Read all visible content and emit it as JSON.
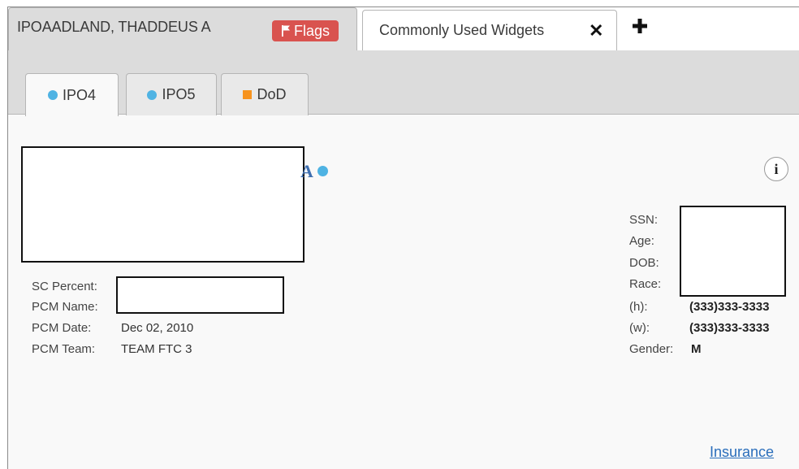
{
  "patient_tab": {
    "name": "IPOAADLAND, THADDEUS A",
    "flags_label": "Flags",
    "flags_color": "#d9534f"
  },
  "widgets_tab": {
    "label": "Commonly Used Widgets",
    "close_icon": "close-icon"
  },
  "add_tab_icon": "plus-icon",
  "site_tabs": [
    {
      "label": "IPO4",
      "indicator": "blue-dot",
      "color": "#4fb3e3",
      "active": true
    },
    {
      "label": "IPO5",
      "indicator": "blue-dot",
      "color": "#4fb3e3",
      "active": false
    },
    {
      "label": "DoD",
      "indicator": "orange-square",
      "color": "#f7931e",
      "active": false
    }
  ],
  "patient_header": {
    "name_visible_suffix": "A",
    "info_icon": "info-icon",
    "info_glyph": "i"
  },
  "left_details": {
    "sc_percent_label": "SC Percent:",
    "pcm_name_label": "PCM Name:",
    "pcm_date_label": "PCM Date:",
    "pcm_date_value": "Dec 02, 2010",
    "pcm_team_label": "PCM Team:",
    "pcm_team_value": "TEAM FTC 3"
  },
  "right_details": {
    "ssn_label": "SSN:",
    "age_label": "Age:",
    "dob_label": "DOB:",
    "race_label": "Race:",
    "home_phone_label": "(h):",
    "home_phone_value": "(333)333-3333",
    "work_phone_label": "(w):",
    "work_phone_value": "(333)333-3333",
    "gender_label": "Gender:",
    "gender_value": "M"
  },
  "insurance_link": "Insurance"
}
